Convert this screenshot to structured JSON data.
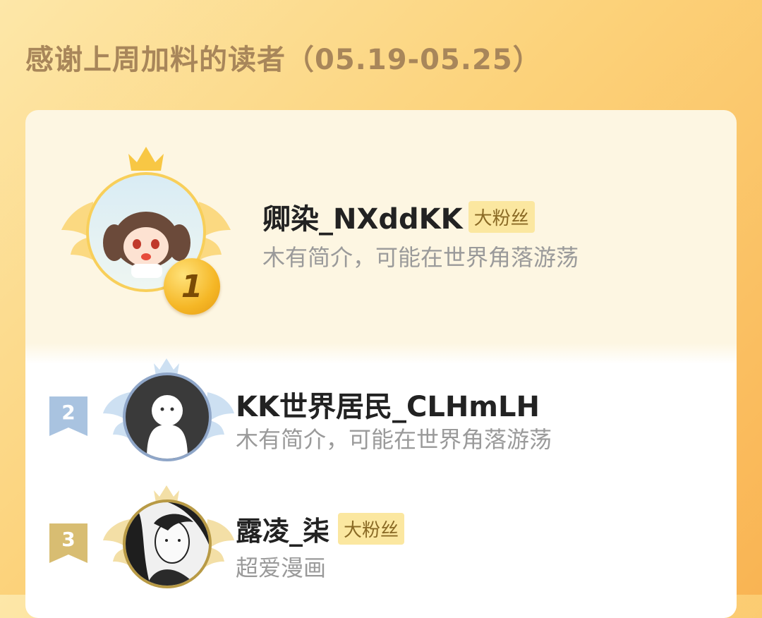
{
  "header": {
    "title": "感谢上周加料的读者（05.19-05.25）"
  },
  "readers": [
    {
      "rank": "1",
      "name": "卿染_NXddKK",
      "badge": "大粉丝",
      "bio": "木有简介，可能在世界角落游荡",
      "avatar": "anime-girl-avatar"
    },
    {
      "rank": "2",
      "name": "KK世界居民_CLHmLH",
      "badge": "",
      "bio": "木有简介，可能在世界角落游荡",
      "avatar": "default-ghost-avatar"
    },
    {
      "rank": "3",
      "name": "露凌_柒",
      "badge": "大粉丝",
      "bio": "超爱漫画",
      "avatar": "bw-illustration-avatar"
    }
  ],
  "colors": {
    "gold": "#f5b726",
    "silver": "#8fb0d8",
    "bronze": "#c9a24a",
    "badge_bg": "#fbe7a0"
  }
}
